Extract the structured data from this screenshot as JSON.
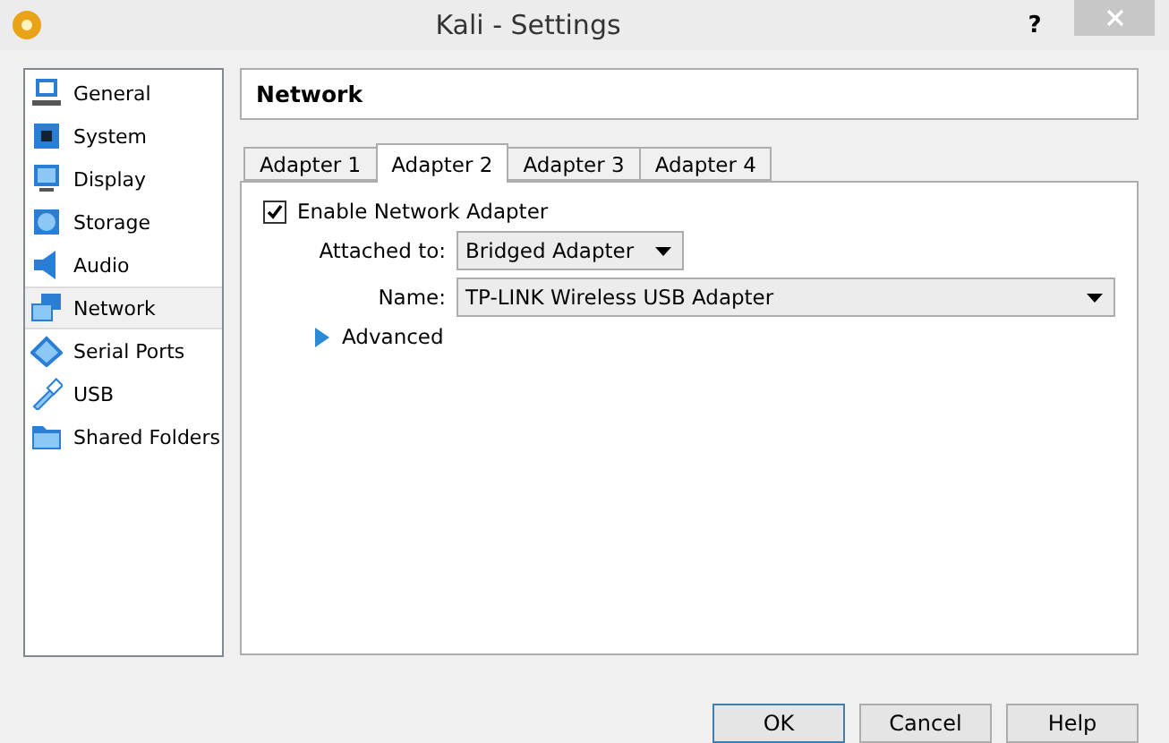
{
  "window": {
    "title": "Kali - Settings",
    "help": "?"
  },
  "sidebar": {
    "items": [
      {
        "label": "General",
        "kind": "general",
        "selected": false
      },
      {
        "label": "System",
        "kind": "system",
        "selected": false
      },
      {
        "label": "Display",
        "kind": "display",
        "selected": false
      },
      {
        "label": "Storage",
        "kind": "storage",
        "selected": false
      },
      {
        "label": "Audio",
        "kind": "audio",
        "selected": false
      },
      {
        "label": "Network",
        "kind": "network",
        "selected": true
      },
      {
        "label": "Serial Ports",
        "kind": "serial",
        "selected": false
      },
      {
        "label": "USB",
        "kind": "usb",
        "selected": false
      },
      {
        "label": "Shared Folders",
        "kind": "folder",
        "selected": false
      }
    ]
  },
  "page_title": "Network",
  "tabs": [
    {
      "label": "Adapter 1",
      "selected": false
    },
    {
      "label": "Adapter 2",
      "selected": true
    },
    {
      "label": "Adapter 3",
      "selected": false
    },
    {
      "label": "Adapter 4",
      "selected": false
    }
  ],
  "enable_adapter": {
    "label": "Enable Network Adapter",
    "checked": true
  },
  "attached_to": {
    "label": "Attached to:",
    "value": "Bridged Adapter"
  },
  "name": {
    "label": "Name:",
    "value": "TP-LINK Wireless USB Adapter"
  },
  "advanced": {
    "label": "Advanced",
    "expanded": false
  },
  "buttons": [
    {
      "label": "OK",
      "selected": true
    },
    {
      "label": "Cancel",
      "selected": false
    },
    {
      "label": "Help",
      "selected": false
    }
  ]
}
